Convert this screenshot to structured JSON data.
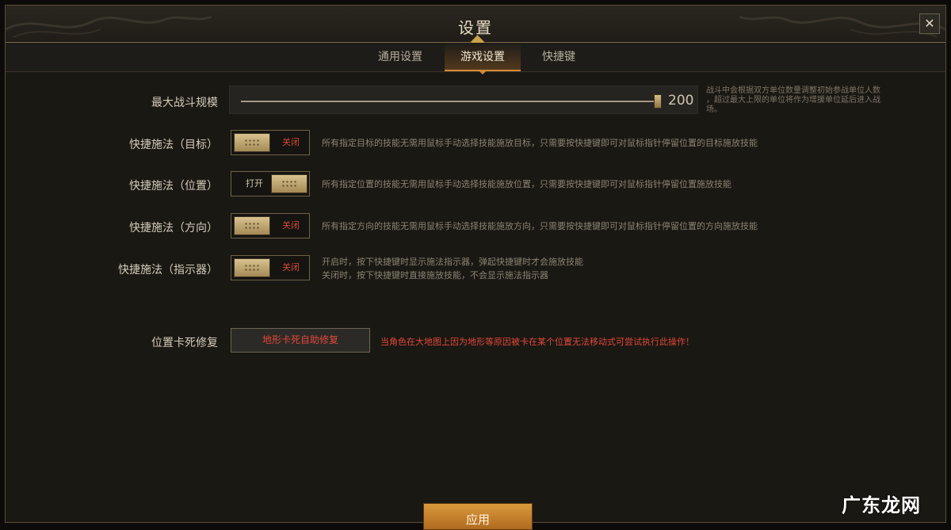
{
  "window": {
    "title": "设置",
    "close_icon": "close-icon"
  },
  "tabs": [
    {
      "label": "通用设置",
      "active": false
    },
    {
      "label": "游戏设置",
      "active": true
    },
    {
      "label": "快捷键",
      "active": false
    }
  ],
  "battle_size": {
    "label": "最大战斗规模",
    "value": "200",
    "level": 1.0,
    "note_line1": "战斗中会根据双方单位数量调整初始参战单位人数",
    "note_line2": "，超过最大上限的单位将作为增援单位延后进入战",
    "note_line3": "场。"
  },
  "settings": [
    {
      "label": "快捷施法（目标）",
      "state": "关闭",
      "on": false,
      "desc": "所有指定目标的技能无需用鼠标手动选择技能施放目标，只需要按快捷键即可对鼠标指针停留位置的目标施放技能"
    },
    {
      "label": "快捷施法（位置）",
      "state": "打开",
      "on": true,
      "desc": "所有指定位置的技能无需用鼠标手动选择技能施放位置，只需要按快捷键即可对鼠标指针停留位置施放技能"
    },
    {
      "label": "快捷施法（方向）",
      "state": "关闭",
      "on": false,
      "desc": "所有指定方向的技能无需用鼠标手动选择技能施放方向，只需要按快捷键即可对鼠标指针停留位置的方向施放技能"
    },
    {
      "label": "快捷施法（指示器）",
      "state": "关闭",
      "on": false,
      "desc_line1": "开启时，按下快捷键时显示施法指示器，弹起快捷键时才会施放技能",
      "desc_line2": "关闭时，按下快捷键时直接施放技能，不会显示施法指示器"
    }
  ],
  "stuck_fix": {
    "label": "位置卡死修复",
    "button": "地形卡死自助修复",
    "warning": "当角色在大地图上因为地形等原因被卡在某个位置无法移动式可尝试执行此操作！"
  },
  "footer": {
    "apply": "应用"
  },
  "watermark": "广东龙网",
  "colors": {
    "accent": "#d28a3a",
    "off": "#d84a3a",
    "warning": "#e0483a",
    "panel": "#1a1813"
  }
}
